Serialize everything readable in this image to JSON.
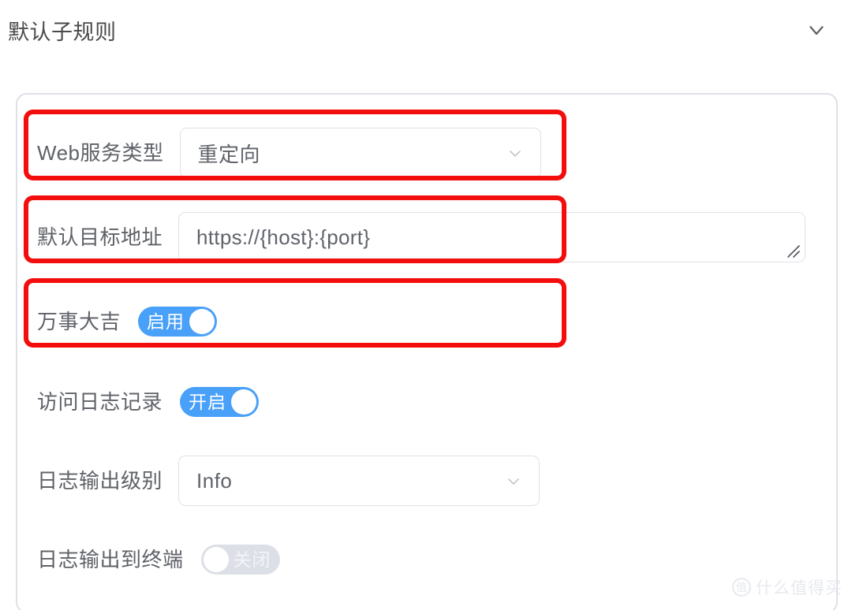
{
  "header": {
    "title": "默认子规则",
    "chevron_icon": "chevron-down-icon"
  },
  "form": {
    "rows": [
      {
        "label": "Web服务类型",
        "control": "select",
        "value": "重定向",
        "arrow_icon": "chevron-down-icon",
        "highlighted": true
      },
      {
        "label": "默认目标地址",
        "control": "textarea",
        "value": "https://{host}:{port}",
        "placeholder": "https://{host}:{port}",
        "resize_icon": "resize-handle-icon",
        "highlighted": true
      },
      {
        "label": "万事大吉",
        "control": "switch",
        "state": "on",
        "state_label": "启用",
        "highlighted": true
      },
      {
        "label": "访问日志记录",
        "control": "switch",
        "state": "on",
        "state_label": "开启",
        "highlighted": false
      },
      {
        "label": "日志输出级别",
        "control": "select",
        "value": "Info",
        "arrow_icon": "chevron-down-icon",
        "highlighted": false
      },
      {
        "label": "日志输出到终端",
        "control": "switch",
        "state": "off",
        "state_label": "关闭",
        "highlighted": false
      }
    ]
  },
  "watermark": {
    "badge": "值",
    "text": "什么值得买"
  },
  "colors": {
    "accent_blue": "#49a0f8",
    "switch_off": "#dcdfe6",
    "border": "#dfe1e8",
    "annotation_red": "#f30d0d",
    "label_text": "#5f6268"
  }
}
